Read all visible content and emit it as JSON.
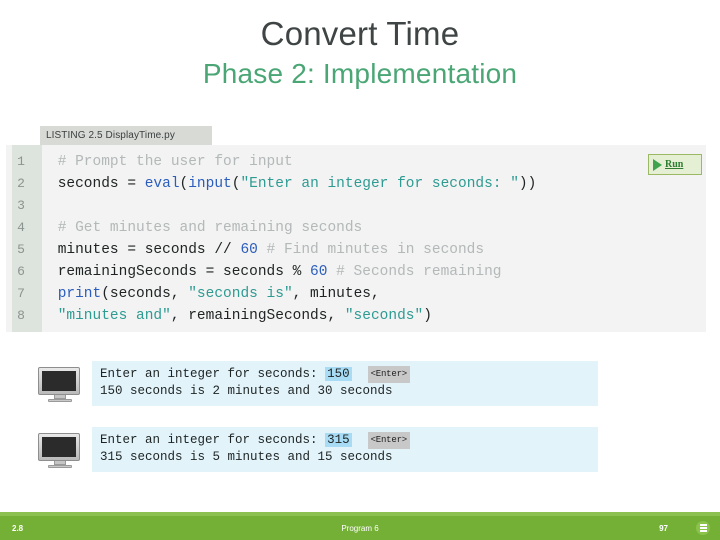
{
  "slide": {
    "title_main": "Convert Time",
    "title_sub": "Phase 2: Implementation"
  },
  "listing": {
    "header": "LISTING 2.5 DisplayTime.py",
    "run_label": "Run",
    "lines": [
      {
        "number": "1",
        "text": "# Prompt the user for input"
      },
      {
        "number": "2",
        "text": "seconds = eval(input(\"Enter an integer for seconds: \"))"
      },
      {
        "number": "3",
        "text": ""
      },
      {
        "number": "4",
        "text": "# Get minutes and remaining seconds"
      },
      {
        "number": "5",
        "text": "minutes = seconds // 60 # Find minutes in seconds"
      },
      {
        "number": "6",
        "text": "remainingSeconds = seconds % 60 # Seconds remaining"
      },
      {
        "number": "7",
        "text": "print(seconds, \"seconds is\", minutes,"
      },
      {
        "number": "8",
        "text": "\"minutes and\", remainingSeconds, \"seconds\")"
      }
    ]
  },
  "consoles": [
    {
      "prompt": "Enter an integer for seconds:",
      "input_value": "150",
      "enter_key": "<Enter>",
      "output": "150 seconds is 2 minutes and 30 seconds"
    },
    {
      "prompt": "Enter an integer for seconds:",
      "input_value": "315",
      "enter_key": "<Enter>",
      "output": "315 seconds is 5 minutes and 15 seconds"
    }
  ],
  "footer": {
    "left": "2.8",
    "center": "Program 6",
    "right": "97",
    "icon": "menu-icon"
  },
  "colors": {
    "title_main": "#3f4444",
    "title_sub": "#4aa675",
    "footer_bar": "#74b036",
    "footer_accent": "#8cc152",
    "console_bg": "#e2f3fa",
    "highlight": "#a8dcf5",
    "code_bg": "#f2f3f2",
    "gutter_bg": "#dde3dd",
    "string_token": "#2e9b93",
    "keyword_token": "#2b5dbd",
    "comment_token": "#b3b8b8"
  }
}
